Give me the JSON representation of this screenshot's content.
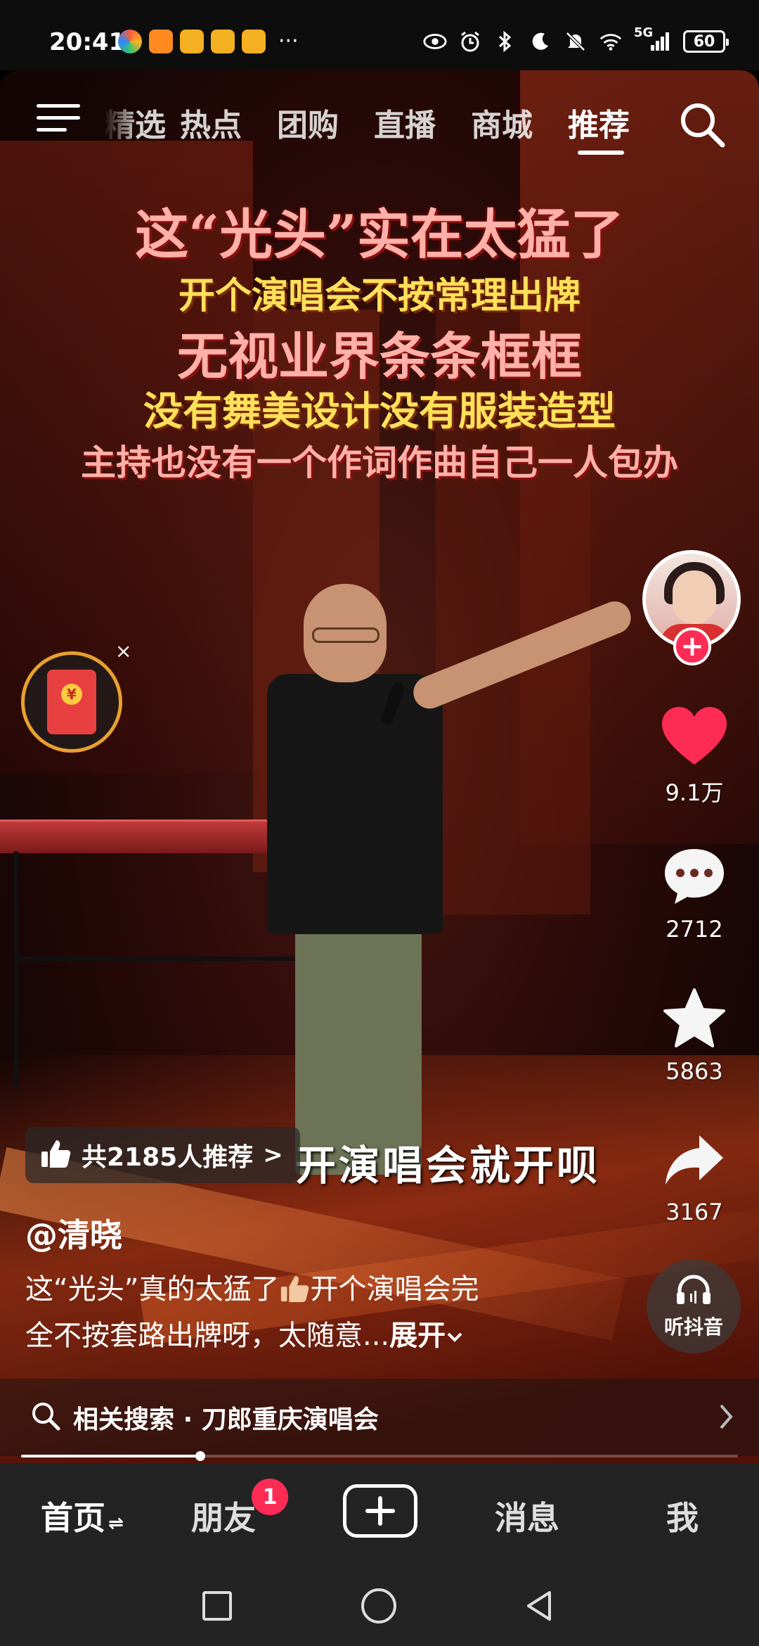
{
  "status_bar": {
    "time": "20:41",
    "more": "···",
    "network": "5G",
    "battery": "60"
  },
  "top_nav": {
    "tabs": [
      "精选",
      "热点",
      "团购",
      "直播",
      "商城",
      "推荐"
    ],
    "active_tab": "推荐"
  },
  "video": {
    "captions": [
      "这“光头”实在太猛了",
      "开个演唱会不按常理出牌",
      "无视业界条条框框",
      "没有舞美设计没有服装造型",
      "主持也没有一个作词作曲自己一人包办"
    ],
    "subtitle": "开演唱会就开呗"
  },
  "actions": {
    "likes": "9.1万",
    "comments": "2712",
    "favorites": "5863",
    "shares": "3167"
  },
  "recommend": {
    "text": "共2185人推荐",
    "arrow": ">"
  },
  "post": {
    "author": "@清晓",
    "desc_line1_a": "这“光头”真的太猛了",
    "desc_line1_b": "开个演唱会完",
    "desc_line2": "全不按套路出牌呀，太随意...",
    "expand": "展开"
  },
  "listen": {
    "label": "听抖音"
  },
  "related_search": {
    "text": "相关搜索 · 刀郎重庆演唱会"
  },
  "progress": {
    "fraction": 0.25
  },
  "bottom_nav": {
    "home": "首页",
    "friends": "朋友",
    "friends_badge": "1",
    "messages": "消息",
    "me": "我"
  },
  "colors": {
    "accent": "#fe2c55",
    "like": "#fe2c55",
    "caption_pink": "#ffb0a8",
    "caption_yellow": "#ffe05a"
  }
}
